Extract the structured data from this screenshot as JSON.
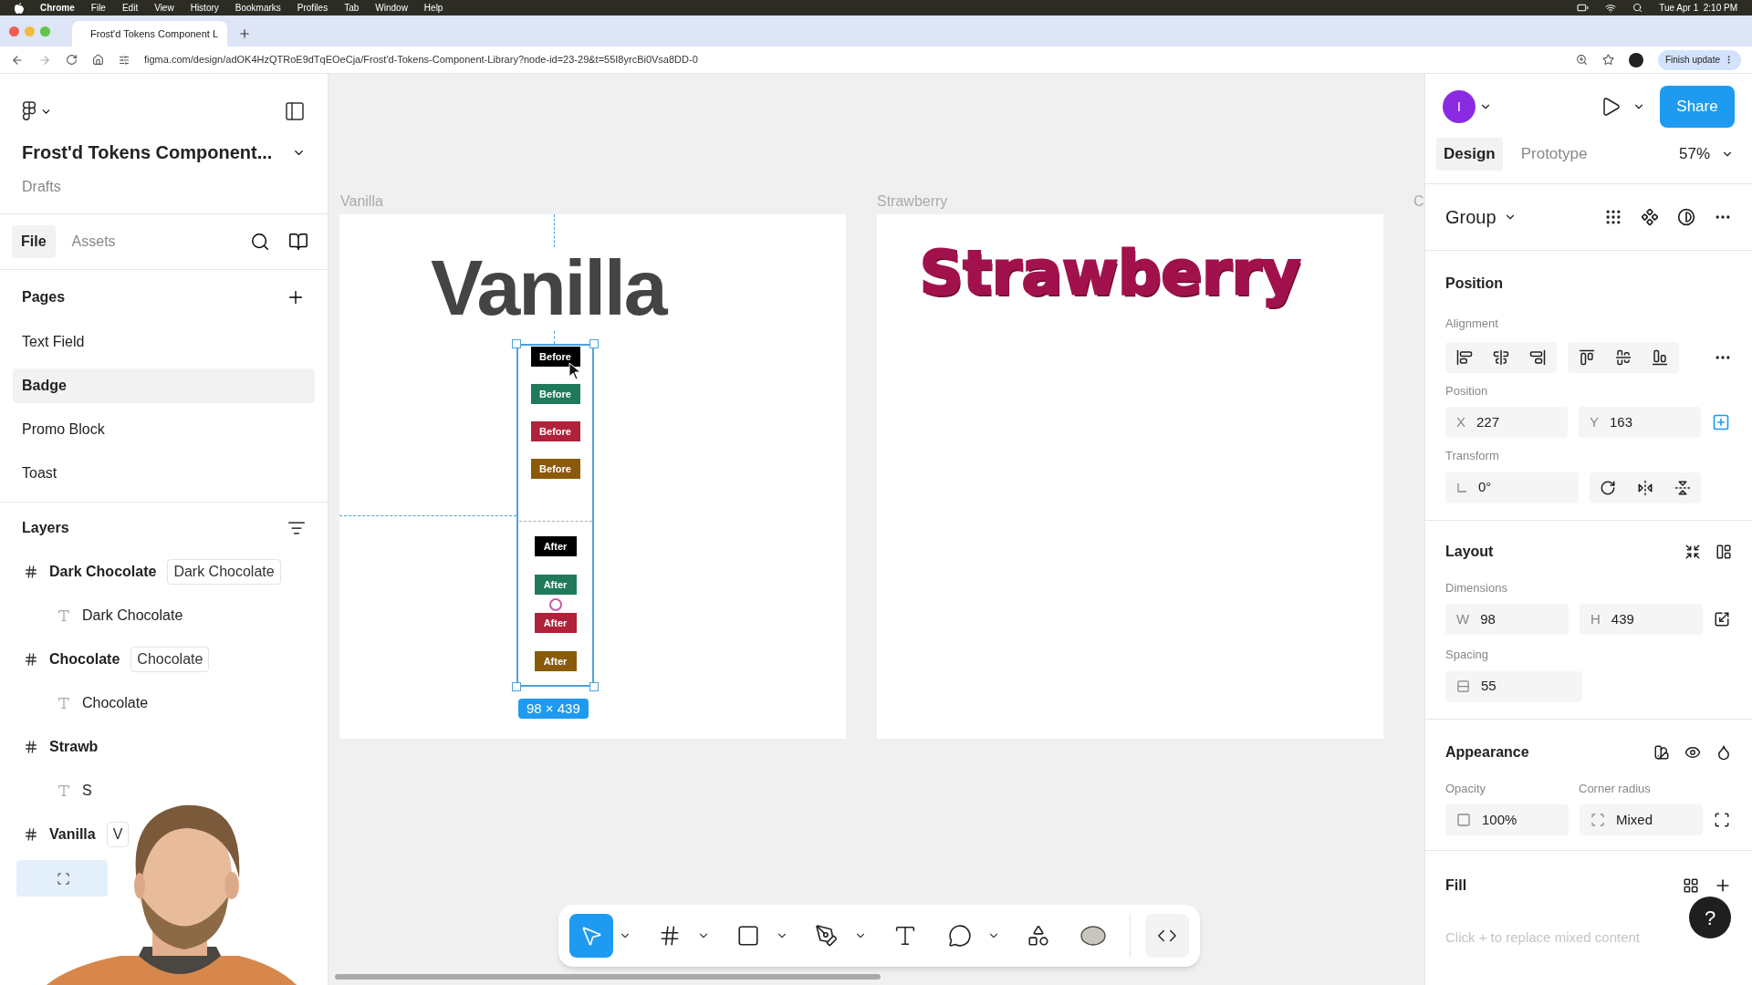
{
  "menu_bar": {
    "app": "Chrome",
    "items": [
      "File",
      "Edit",
      "View",
      "History",
      "Bookmarks",
      "Profiles",
      "Tab",
      "Window",
      "Help"
    ],
    "clock": "Tue Apr 1  2:10 PM"
  },
  "browser": {
    "tab_title": "Frost'd Tokens Component L",
    "url": "figma.com/design/adOK4HzQTRoE9dTqEOeCja/Frost'd-Tokens-Component-Library?node-id=23-29&t=55I8yrcBi0Vsa8DD-0",
    "update_button": "Finish update"
  },
  "left_panel": {
    "file_title": "Frost'd Tokens Component...",
    "location": "Drafts",
    "tabs": [
      {
        "label": "File",
        "selected": true
      },
      {
        "label": "Assets",
        "selected": false
      }
    ],
    "pages_heading": "Pages",
    "pages": [
      {
        "label": "Text Field",
        "selected": false
      },
      {
        "label": "Badge",
        "selected": true
      },
      {
        "label": "Promo Block",
        "selected": false
      },
      {
        "label": "Toast",
        "selected": false
      }
    ],
    "layers_heading": "Layers",
    "layers": [
      {
        "kind": "frame",
        "name": "Dark Chocolate",
        "tag": "Dark Chocolate",
        "selected": false,
        "children": [
          {
            "kind": "text",
            "name": "Dark Chocolate",
            "selected": false
          }
        ]
      },
      {
        "kind": "frame",
        "name": "Chocolate",
        "tag": "Chocolate",
        "selected": false,
        "children": [
          {
            "kind": "text",
            "name": "Chocolate",
            "selected": false
          }
        ]
      },
      {
        "kind": "frame",
        "name": "Strawb",
        "selected": false,
        "children": [
          {
            "kind": "text",
            "name": "S",
            "selected": false
          }
        ]
      },
      {
        "kind": "frame",
        "name": "Vanilla",
        "tag": "V",
        "selected": false,
        "children": [
          {
            "kind": "group",
            "selected": true
          }
        ]
      }
    ]
  },
  "canvas": {
    "frames": [
      {
        "kind": "vanilla",
        "label": "Vanilla",
        "heading": "Vanilla"
      },
      {
        "kind": "strawberry",
        "label": "Strawberry",
        "heading": "Strawberry"
      }
    ],
    "offscreen_label": "C",
    "badges_before": [
      {
        "text": "Before",
        "color": "#000000"
      },
      {
        "text": "Before",
        "color": "#1f7a5a"
      },
      {
        "text": "Before",
        "color": "#b0213a"
      },
      {
        "text": "Before",
        "color": "#8a5a0a"
      }
    ],
    "badges_after": [
      {
        "text": "After",
        "color": "#000000"
      },
      {
        "text": "After",
        "color": "#1f7a5a"
      },
      {
        "text": "After",
        "color": "#b0213a"
      },
      {
        "text": "After",
        "color": "#8a5a0a"
      }
    ],
    "selection_size": "98 × 439",
    "tools": [
      {
        "kind": "move",
        "selected": true,
        "menu": true
      },
      {
        "kind": "frame",
        "selected": false,
        "menu": true
      },
      {
        "kind": "shape",
        "selected": false,
        "menu": true
      },
      {
        "kind": "pen",
        "selected": false,
        "menu": true
      },
      {
        "kind": "text",
        "selected": false,
        "menu": false
      },
      {
        "kind": "comment",
        "selected": false,
        "menu": true
      },
      {
        "kind": "assets",
        "selected": false,
        "menu": false
      },
      {
        "kind": "ai",
        "selected": false,
        "menu": false
      },
      {
        "kind": "dev",
        "selected": false,
        "menu": false
      }
    ]
  },
  "right_panel": {
    "avatar": "I",
    "share": "Share",
    "tabs": [
      {
        "label": "Design",
        "selected": true
      },
      {
        "label": "Prototype",
        "selected": false
      }
    ],
    "zoom": "57%",
    "selection_type": "Group",
    "position_heading": "Position",
    "alignment_label": "Alignment",
    "position_label": "Position",
    "x": {
      "label": "X",
      "value": "227"
    },
    "y": {
      "label": "Y",
      "value": "163"
    },
    "transform_label": "Transform",
    "rotation": "0°",
    "layout_heading": "Layout",
    "dimensions_label": "Dimensions",
    "w": {
      "label": "W",
      "value": "98"
    },
    "h": {
      "label": "H",
      "value": "439"
    },
    "spacing_label": "Spacing",
    "spacing": "55",
    "appearance_heading": "Appearance",
    "opacity_label": "Opacity",
    "opacity": "100%",
    "radius_label": "Corner radius",
    "radius": "Mixed",
    "fill_heading": "Fill",
    "fill_hint": "Click + to replace mixed content",
    "help": "?"
  }
}
